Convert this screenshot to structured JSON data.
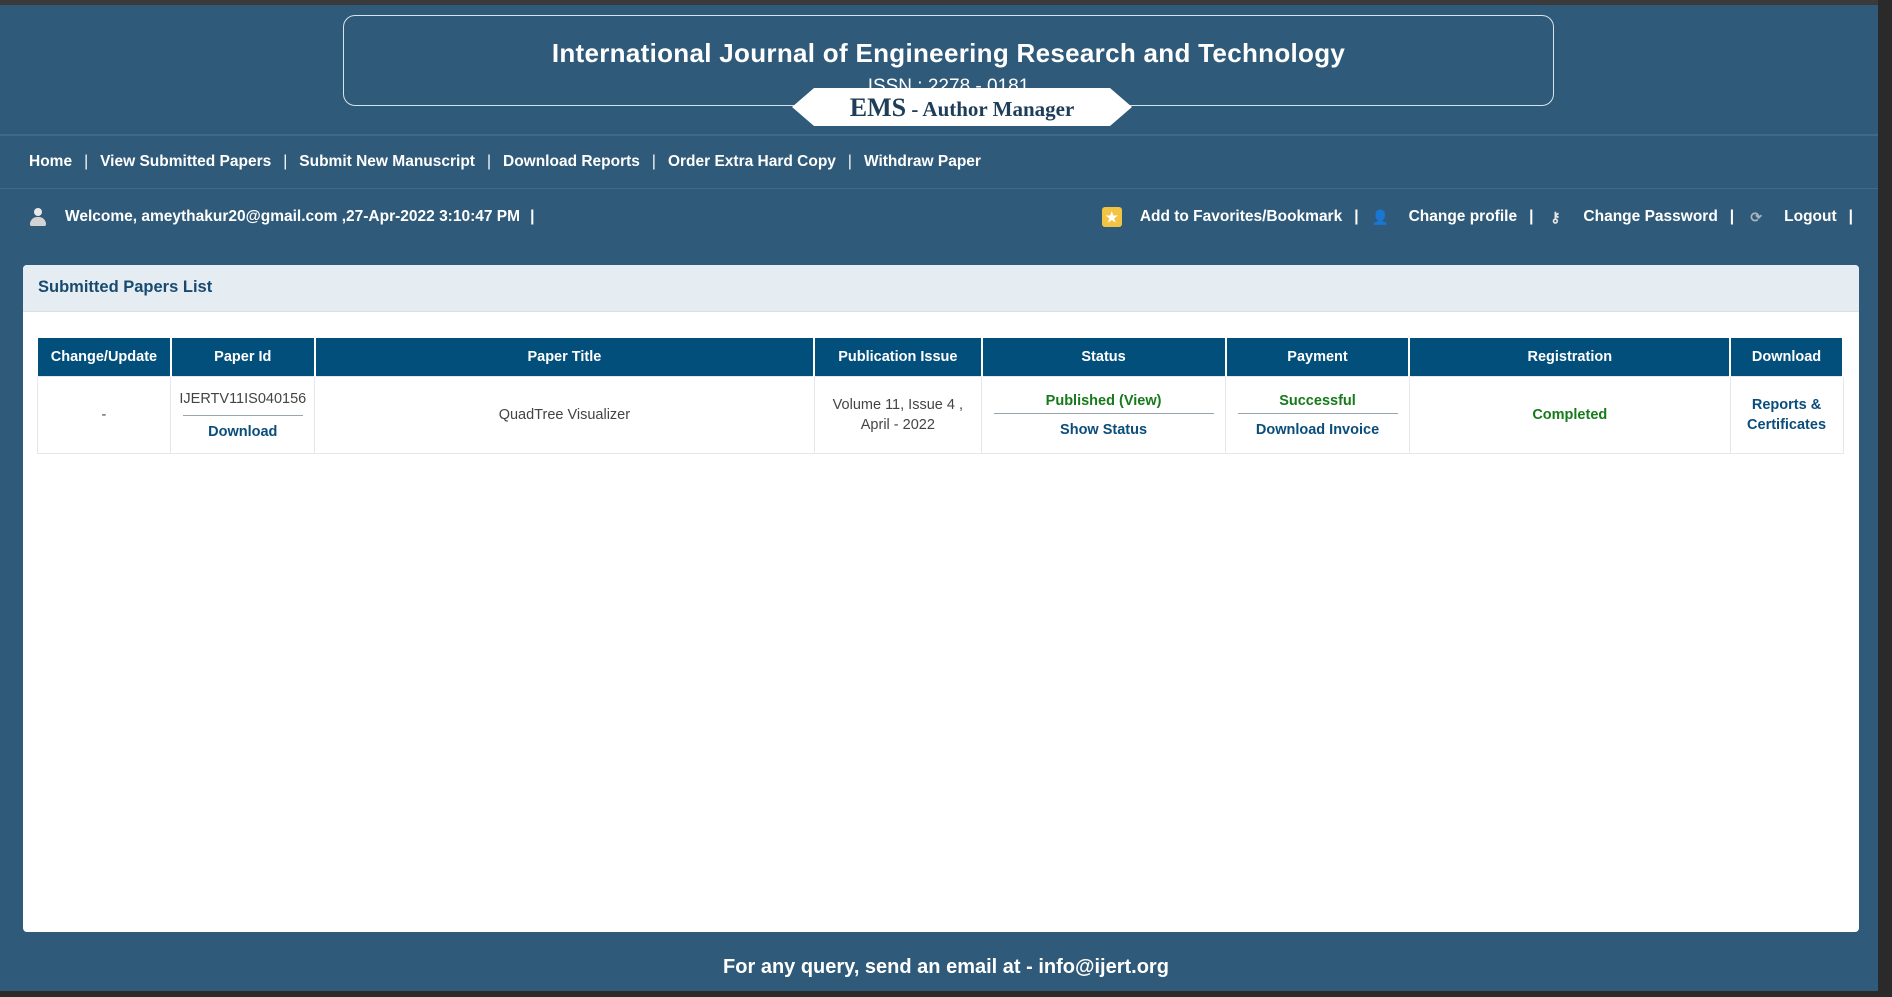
{
  "header": {
    "journal_title": "International Journal of Engineering Research and Technology",
    "issn": "ISSN : 2278 - 0181",
    "ems_big": "EMS",
    "ems_small": " - Author Manager"
  },
  "nav": {
    "items": [
      {
        "label": "Home"
      },
      {
        "label": "View Submitted Papers"
      },
      {
        "label": "Submit New Manuscript"
      },
      {
        "label": "Download Reports"
      },
      {
        "label": "Order Extra Hard Copy"
      },
      {
        "label": "Withdraw Paper"
      }
    ],
    "separator": "|"
  },
  "welcome": {
    "text": "Welcome, ameythakur20@gmail.com ,27-Apr-2022 3:10:47 PM",
    "separator": "|"
  },
  "actions": {
    "bookmark": "Add to Favorites/Bookmark",
    "change_profile": "Change profile",
    "change_password": "Change Password",
    "logout": "Logout",
    "separator": "|"
  },
  "panel": {
    "title": "Submitted Papers List"
  },
  "table": {
    "headers": [
      "Change/Update",
      "Paper Id",
      "Paper Title",
      "Publication Issue",
      "Status",
      "Payment",
      "Registration",
      "Download"
    ],
    "rows": [
      {
        "change_update": "-",
        "paper_id": "IJERTV11IS040156",
        "paper_download": "Download",
        "paper_title": "QuadTree Visualizer",
        "publication_issue_line1": "Volume 11, Issue 4 ,",
        "publication_issue_line2": "April - 2022",
        "status": "Published (View)",
        "show_status": "Show Status",
        "payment": "Successful",
        "download_invoice": "Download Invoice",
        "registration": "Completed",
        "download_line1": "Reports &",
        "download_line2": "Certificates"
      }
    ]
  },
  "footer": {
    "text": "For any query, send an email at - info@ijert.org"
  },
  "colors": {
    "background": "#2f5a79",
    "table_header": "#034f7c",
    "link": "#0a4d7b",
    "success": "#167a1b"
  }
}
